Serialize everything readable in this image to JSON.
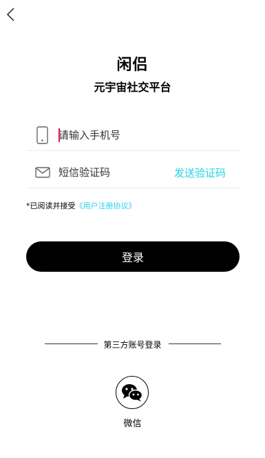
{
  "header": {
    "back_icon": "chevron-left-icon"
  },
  "brand": {
    "title": "闲侣",
    "subtitle": "元宇宙社交平台"
  },
  "form": {
    "phone": {
      "icon": "phone-icon",
      "placeholder": "请输入手机号",
      "value": ""
    },
    "code": {
      "icon": "envelope-icon",
      "placeholder": "短信验证码",
      "value": "",
      "send_label": "发送验证码"
    }
  },
  "agreement": {
    "prefix": "*已阅读并接受",
    "link": "《用户注册协议》"
  },
  "login_button": {
    "label": "登录"
  },
  "third_party": {
    "divider_label": "第三方账号登录",
    "wechat": {
      "icon": "wechat-icon",
      "label": "微信"
    }
  },
  "colors": {
    "accent": "#20d4e6",
    "primary_button": "#000000",
    "caret": "#e0104d"
  }
}
